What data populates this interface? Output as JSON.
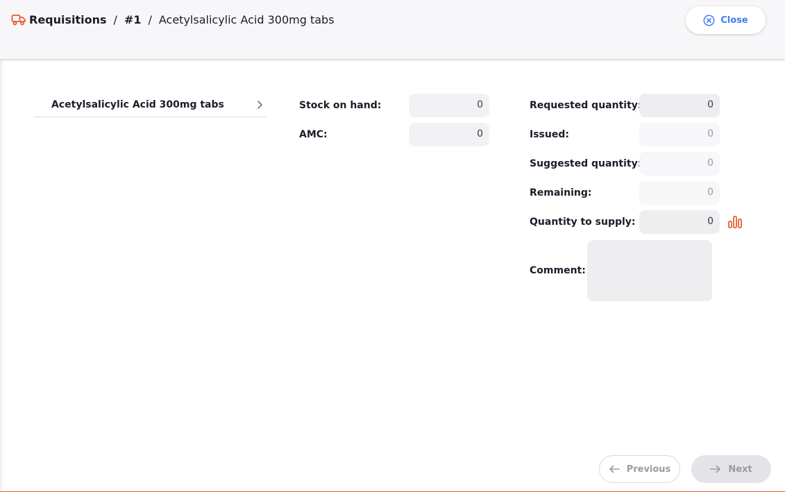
{
  "header": {
    "breadcrumb": {
      "root": "Requisitions",
      "separator": "/",
      "number": "#1",
      "item": "Acetylsalicylic Acid 300mg tabs"
    },
    "close_label": "Close",
    "icon": "truck-icon"
  },
  "item_list": {
    "items": [
      {
        "label": "Acetylsalicylic Acid 300mg tabs"
      }
    ]
  },
  "stock_panel": {
    "stock_on_hand": {
      "label": "Stock on hand:",
      "value": "0"
    },
    "amc": {
      "label": "AMC:",
      "value": "0"
    }
  },
  "request_panel": {
    "requested_quantity": {
      "label": "Requested quantity:",
      "value": "0"
    },
    "issued": {
      "label": "Issued:",
      "value": "0"
    },
    "suggested_quantity": {
      "label": "Suggested quantity:",
      "value": "0"
    },
    "remaining": {
      "label": "Remaining:",
      "value": "0"
    },
    "quantity_to_supply": {
      "label": "Quantity to supply:",
      "value": "0"
    },
    "comment": {
      "label": "Comment:",
      "value": ""
    }
  },
  "footer": {
    "previous_label": "Previous",
    "next_label": "Next"
  },
  "colors": {
    "accent": "#e95c30",
    "link": "#3e7bfa",
    "field_bg": "#eeeef0"
  }
}
